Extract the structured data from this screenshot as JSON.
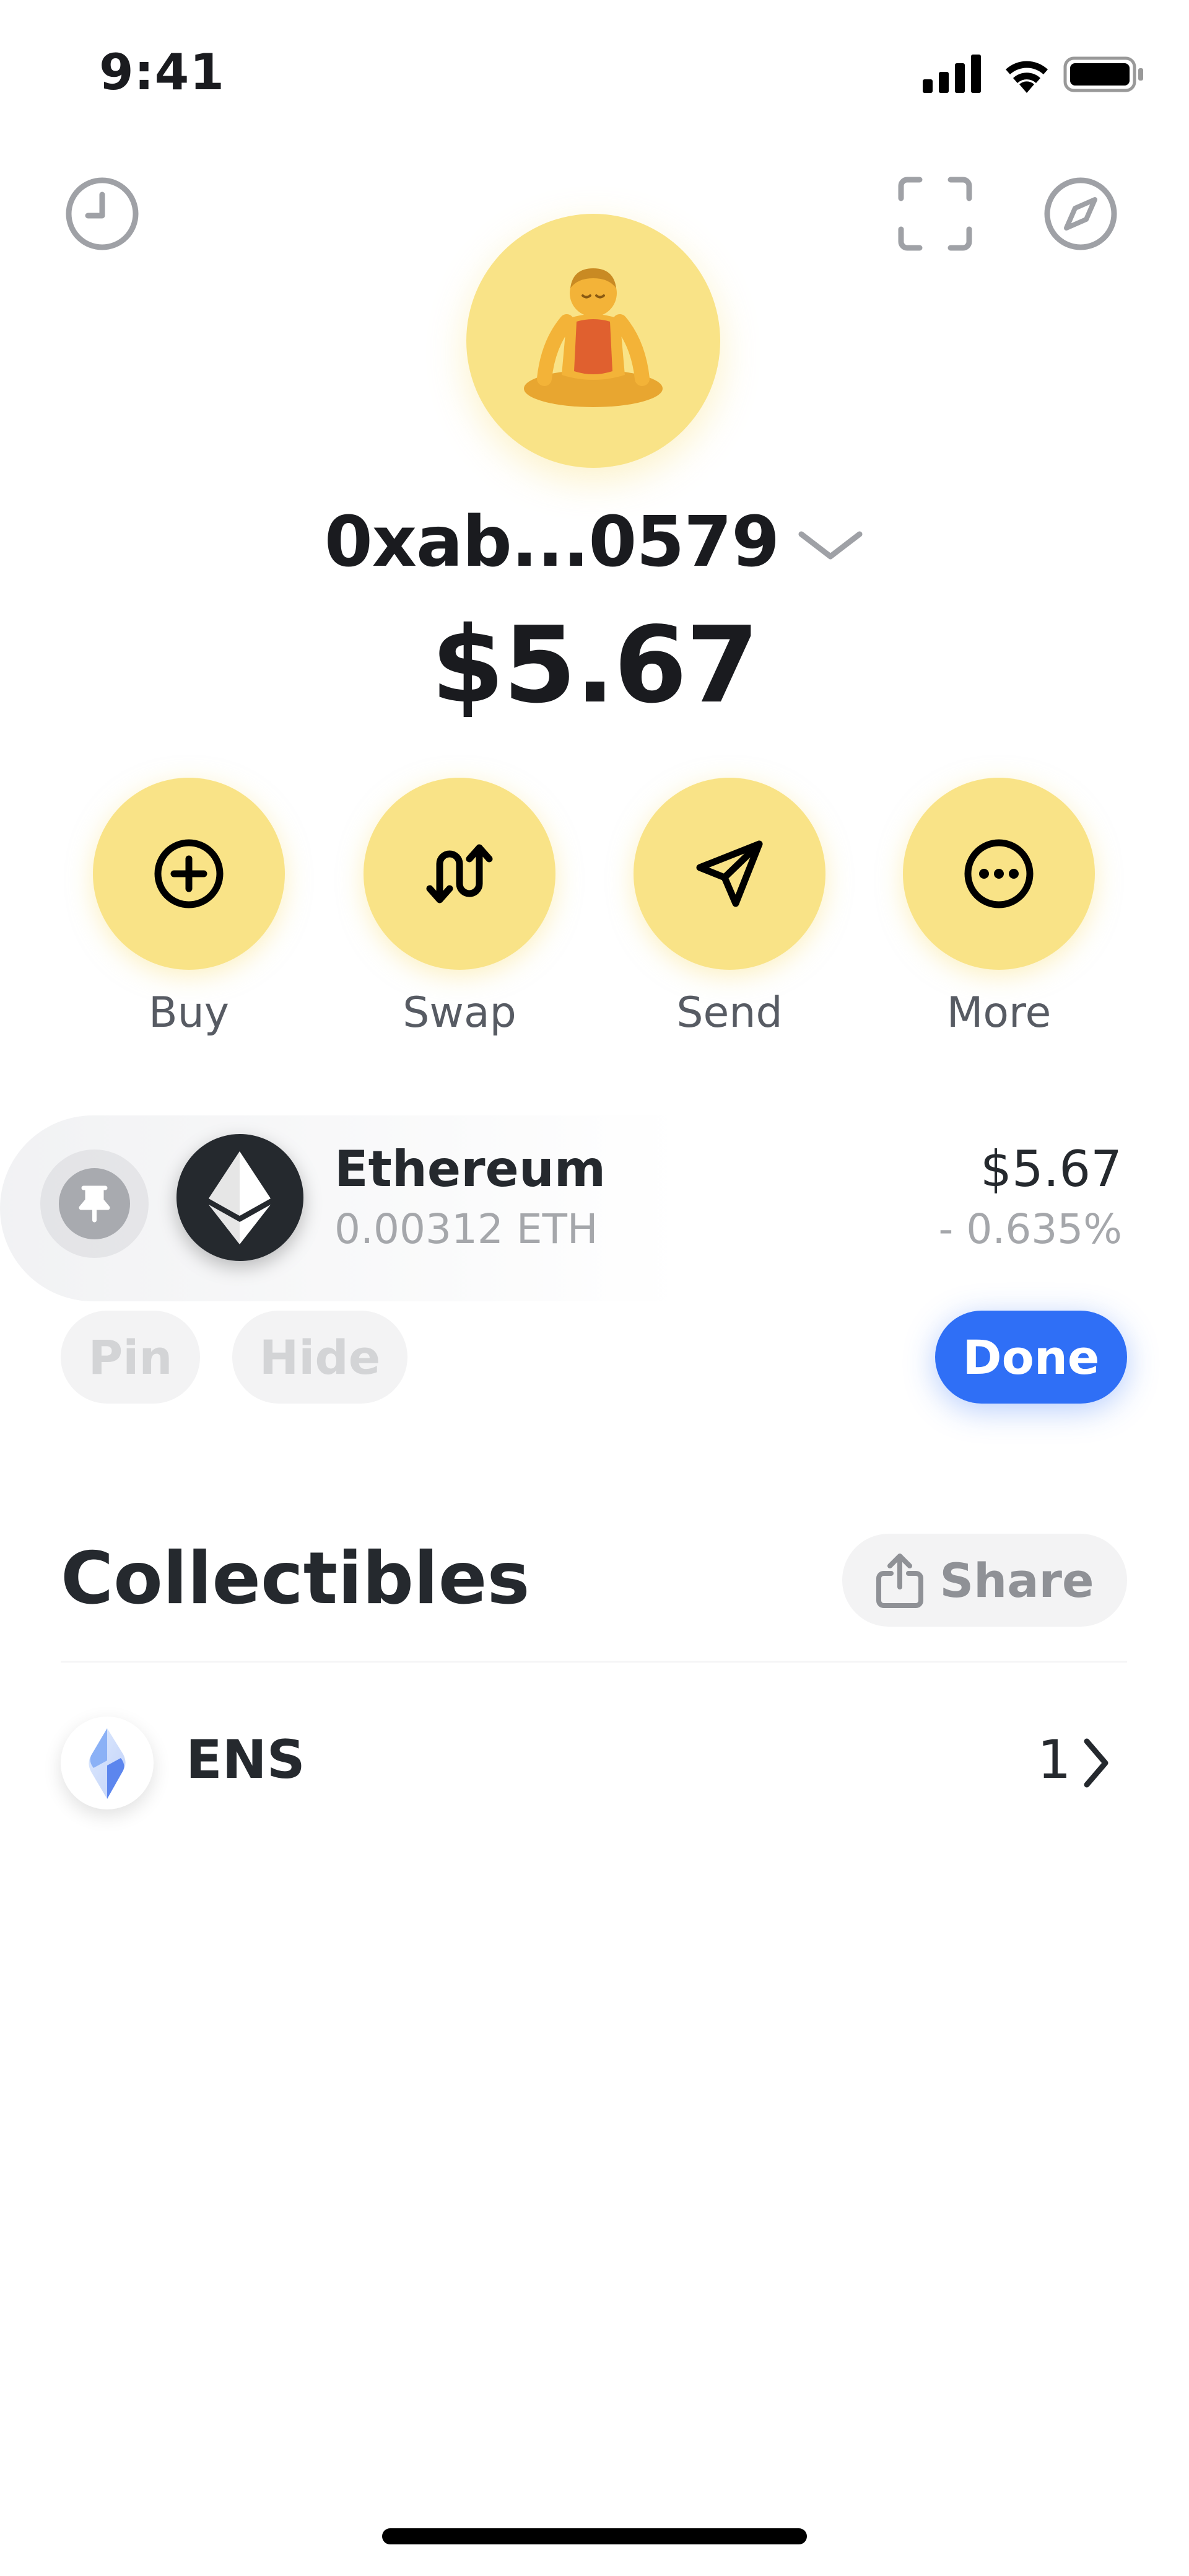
{
  "status_bar": {
    "time": "9:41",
    "icons": [
      "signal-icon",
      "wifi-icon",
      "battery-icon"
    ]
  },
  "top_nav": {
    "left_icon": "history-clock-icon",
    "right_icons": [
      "scan-qr-icon",
      "discover-compass-icon"
    ]
  },
  "profile": {
    "avatar_emoji": "🧘",
    "avatar_color": "#f9e387",
    "address": "0xab...0579",
    "balance": "$5.67"
  },
  "actions": [
    {
      "label": "Buy",
      "icon": "plus-circle-icon"
    },
    {
      "label": "Swap",
      "icon": "swap-arrows-icon"
    },
    {
      "label": "Send",
      "icon": "send-paper-plane-icon"
    },
    {
      "label": "More",
      "icon": "more-dots-icon"
    }
  ],
  "token": {
    "name": "Ethereum",
    "amount": "0.00312 ETH",
    "value": "$5.67",
    "change": "- 0.635%"
  },
  "edit_controls": {
    "pin_label": "Pin",
    "hide_label": "Hide",
    "done_label": "Done",
    "done_color": "#2f6ff6"
  },
  "collectibles": {
    "title": "Collectibles",
    "share_label": "Share",
    "items": [
      {
        "name": "ENS",
        "count": "1"
      }
    ]
  }
}
